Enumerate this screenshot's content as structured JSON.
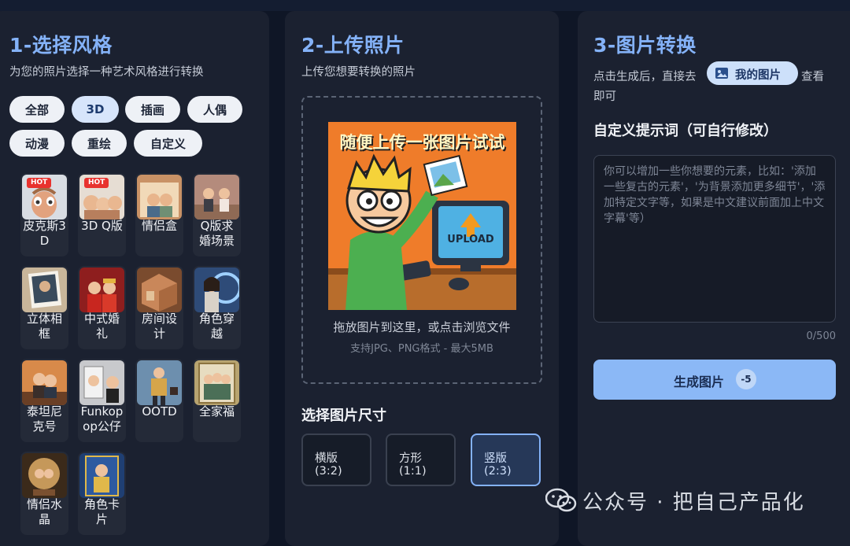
{
  "col1": {
    "title": "1-选择风格",
    "subtitle": "为您的照片选择一种艺术风格进行转换",
    "filters": [
      {
        "label": "全部",
        "active": false
      },
      {
        "label": "3D",
        "active": true
      },
      {
        "label": "插画",
        "active": false
      },
      {
        "label": "人偶",
        "active": false
      },
      {
        "label": "动漫",
        "active": false
      },
      {
        "label": "重绘",
        "active": false
      },
      {
        "label": "自定义",
        "active": false
      }
    ],
    "styles": [
      {
        "label": "皮克斯3D",
        "badge": "HOT"
      },
      {
        "label": "3D Q版",
        "badge": "HOT"
      },
      {
        "label": "情侣盒",
        "badge": ""
      },
      {
        "label": "Q版求婚场景",
        "badge": ""
      },
      {
        "label": "立体相框",
        "badge": ""
      },
      {
        "label": "中式婚礼",
        "badge": ""
      },
      {
        "label": "房间设计",
        "badge": ""
      },
      {
        "label": "角色穿越",
        "badge": ""
      },
      {
        "label": "泰坦尼克号",
        "badge": ""
      },
      {
        "label": "Funkopop公仔",
        "badge": ""
      },
      {
        "label": "OOTD",
        "badge": ""
      },
      {
        "label": "全家福",
        "badge": ""
      },
      {
        "label": "情侣水晶",
        "badge": ""
      },
      {
        "label": "角色卡片",
        "badge": ""
      }
    ]
  },
  "col2": {
    "title": "2-上传照片",
    "subtitle": "上传您想要转换的照片",
    "illustration_title": "随便上传一张图片试试",
    "illustration_screen_text": "UPLOAD",
    "drop_text": "拖放图片到这里，或点击浏览文件",
    "drop_hint": "支持JPG、PNG格式 - 最大5MB",
    "size_title": "选择图片尺寸",
    "sizes": [
      {
        "name": "横版",
        "ratio": "(3:2)",
        "selected": false
      },
      {
        "name": "方形",
        "ratio": "(1:1)",
        "selected": false
      },
      {
        "name": "竖版",
        "ratio": "(2:3)",
        "selected": true
      }
    ]
  },
  "col3": {
    "title": "3-图片转换",
    "desc_before": "点击生成后，直接去",
    "my_images_button": "我的图片",
    "desc_after_1": "查看",
    "desc_after_2": "即可",
    "prompt_title": "自定义提示词（可自行修改）",
    "prompt_placeholder": "你可以增加一些你想要的元素，比如：'添加一些复古的元素'，'为背景添加更多细节'，'添加特定文字等，如果是中文建议前面加上中文字幕'等）",
    "char_count": "0/500",
    "generate_button": "生成图片",
    "cost": "-5"
  },
  "watermark": "公众号 · 把自己产品化",
  "colors": {
    "accent": "#84b2f8",
    "background": "#0f1626",
    "panel": "#1b2130",
    "hot_badge": "#e8322e"
  }
}
